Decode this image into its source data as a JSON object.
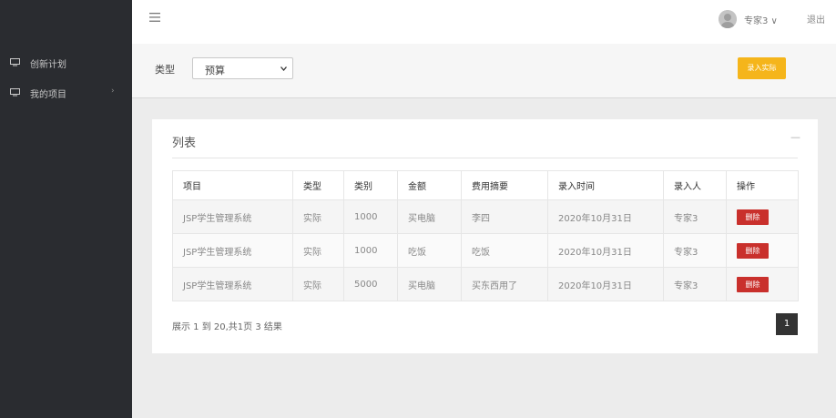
{
  "sidebar": {
    "items": [
      {
        "label": "创新计划",
        "icon": "monitor-icon"
      },
      {
        "label": "我的项目",
        "icon": "monitor-icon",
        "chevron": "›"
      }
    ]
  },
  "header": {
    "menu_icon": "menu-icon",
    "user": "专家3 ∨",
    "logout": "退出"
  },
  "filter": {
    "label": "类型",
    "selected": "预算",
    "enter_button": "录入实际"
  },
  "panel": {
    "title": "列表",
    "collapse": "—"
  },
  "table": {
    "headers": [
      "项目",
      "类型",
      "类别",
      "金额",
      "费用摘要",
      "录入时间",
      "录入人",
      "操作"
    ],
    "rows": [
      {
        "project": "JSP学生管理系统",
        "type": "实际",
        "category": "1000",
        "amount": "买电脑",
        "summary": "李四",
        "time": "2020年10月31日",
        "entered_by": "专家3",
        "action": "删除"
      },
      {
        "project": "JSP学生管理系统",
        "type": "实际",
        "category": "1000",
        "amount": "吃饭",
        "summary": "吃饭",
        "time": "2020年10月31日",
        "entered_by": "专家3",
        "action": "删除"
      },
      {
        "project": "JSP学生管理系统",
        "type": "实际",
        "category": "5000",
        "amount": "买电脑",
        "summary": "买东西用了",
        "time": "2020年10月31日",
        "entered_by": "专家3",
        "action": "删除"
      }
    ]
  },
  "footer": {
    "summary": "展示 1 到 20,共1页 3 结果",
    "page": "1"
  },
  "colors": {
    "sidebar_bg": "#2a2c30",
    "accent_yellow": "#f5b51b",
    "danger_red": "#c9302c",
    "pager_bg": "#333333"
  }
}
